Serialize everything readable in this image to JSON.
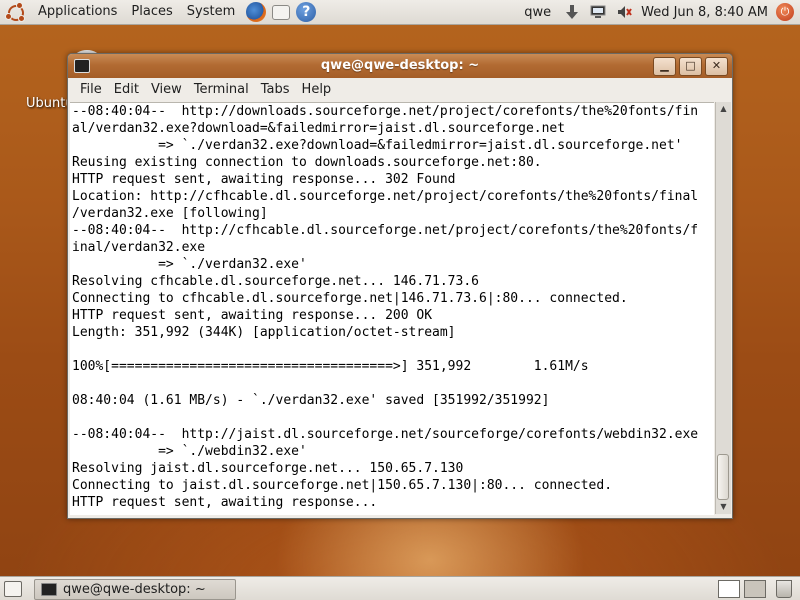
{
  "top_panel": {
    "menus": [
      "Applications",
      "Places",
      "System"
    ],
    "launchers": [
      "firefox-icon",
      "mail-icon",
      "help-icon"
    ],
    "help_glyph": "?",
    "username": "qwe",
    "clock": "Wed Jun  8,  8:40 AM"
  },
  "desktop": {
    "icon_label": "Ubuntu"
  },
  "window": {
    "title": "qwe@qwe-desktop: ~",
    "menubar": [
      "File",
      "Edit",
      "View",
      "Terminal",
      "Tabs",
      "Help"
    ],
    "scroll_thumb_fraction": 0.12,
    "scroll_position_fraction": 1.0,
    "terminal_lines": [
      "--08:40:04--  http://downloads.sourceforge.net/project/corefonts/the%20fonts/fin",
      "al/verdan32.exe?download=&failedmirror=jaist.dl.sourceforge.net",
      "           => `./verdan32.exe?download=&failedmirror=jaist.dl.sourceforge.net'",
      "Reusing existing connection to downloads.sourceforge.net:80.",
      "HTTP request sent, awaiting response... 302 Found",
      "Location: http://cfhcable.dl.sourceforge.net/project/corefonts/the%20fonts/final",
      "/verdan32.exe [following]",
      "--08:40:04--  http://cfhcable.dl.sourceforge.net/project/corefonts/the%20fonts/f",
      "inal/verdan32.exe",
      "           => `./verdan32.exe'",
      "Resolving cfhcable.dl.sourceforge.net... 146.71.73.6",
      "Connecting to cfhcable.dl.sourceforge.net|146.71.73.6|:80... connected.",
      "HTTP request sent, awaiting response... 200 OK",
      "Length: 351,992 (344K) [application/octet-stream]",
      "",
      "100%[====================================>] 351,992        1.61M/s",
      "",
      "08:40:04 (1.61 MB/s) - `./verdan32.exe' saved [351992/351992]",
      "",
      "--08:40:04--  http://jaist.dl.sourceforge.net/sourceforge/corefonts/webdin32.exe",
      "           => `./webdin32.exe'",
      "Resolving jaist.dl.sourceforge.net... 150.65.7.130",
      "Connecting to jaist.dl.sourceforge.net|150.65.7.130|:80... connected.",
      "HTTP request sent, awaiting response..."
    ]
  },
  "bottom_panel": {
    "task_label": "qwe@qwe-desktop: ~",
    "workspaces": 2,
    "active_workspace": 1
  }
}
